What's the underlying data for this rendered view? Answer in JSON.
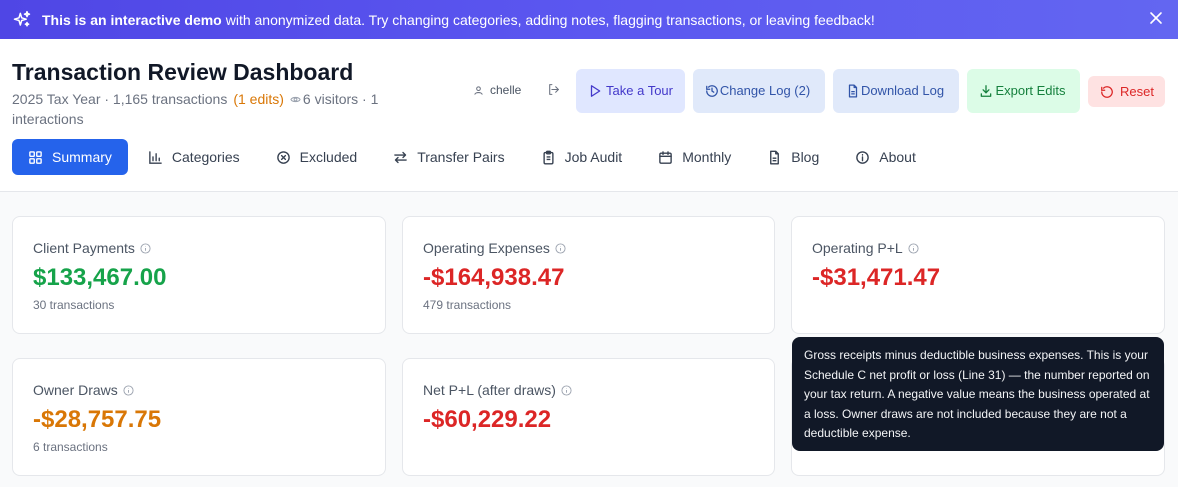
{
  "banner": {
    "bold_text": "This is an interactive demo",
    "text": "with anonymized data. Try changing categories, adding notes, flagging transactions, or leaving feedback!"
  },
  "header": {
    "title": "Transaction Review Dashboard",
    "subtitle_lead": "2025 Tax Year · 1,165 transactions",
    "edits": "(1 edits)",
    "visitors": "6 visitors · 1 interactions",
    "user": "chelle"
  },
  "buttons": {
    "tour": "Take a Tour",
    "change_log": "Change Log (2)",
    "download_log": "Download Log",
    "export_edits": "Export Edits",
    "reset": "Reset"
  },
  "tabs": [
    {
      "label": "Summary",
      "icon": "grid-icon",
      "active": true
    },
    {
      "label": "Categories",
      "icon": "bar-chart-icon"
    },
    {
      "label": "Excluded",
      "icon": "x-circle-icon"
    },
    {
      "label": "Transfer Pairs",
      "icon": "arrows-icon"
    },
    {
      "label": "Job Audit",
      "icon": "clipboard-icon"
    },
    {
      "label": "Monthly",
      "icon": "calendar-icon"
    },
    {
      "label": "Blog",
      "icon": "document-icon"
    },
    {
      "label": "About",
      "icon": "info-icon"
    }
  ],
  "cards": [
    {
      "label": "Client Payments",
      "value": "$133,467.00",
      "sub": "30 transactions",
      "color": "#16a34a"
    },
    {
      "label": "Operating Expenses",
      "value": "-$164,938.47",
      "sub": "479 transactions",
      "color": "#dc2626"
    },
    {
      "label": "Operating P+L",
      "value": "-$31,471.47",
      "sub": "",
      "color": "#dc2626"
    },
    {
      "label": "Owner Draws",
      "value": "-$28,757.75",
      "sub": "6 transactions",
      "color": "#d97706"
    },
    {
      "label": "Net P+L (after draws)",
      "value": "-$60,229.22",
      "sub": "",
      "color": "#dc2626"
    }
  ],
  "tooltip": "Gross receipts minus deductible business expenses. This is your Schedule C net profit or loss (Line 31) — the number reported on your tax return. A negative value means the business operated at a loss. Owner draws are not included because they are not a deductible expense.",
  "colors": {
    "accent": "#2563eb",
    "banner": "#4f46e5"
  }
}
